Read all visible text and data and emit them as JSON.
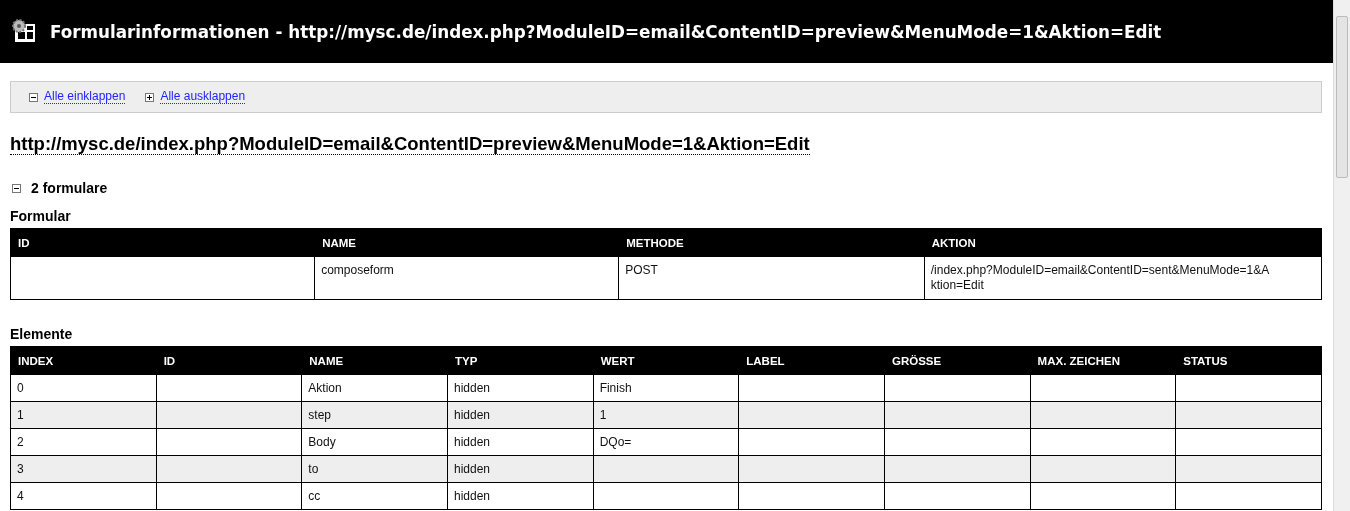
{
  "title_bar": {
    "title": "Formularinformationen - http://mysc.de/index.php?ModuleID=email&ContentID=preview&MenuMode=1&Aktion=Edit"
  },
  "toolbar": [
    {
      "label": "Alle einklappen",
      "kind": "collapse"
    },
    {
      "label": "Alle ausklappen",
      "kind": "expand"
    }
  ],
  "url_heading": "http://mysc.de/index.php?ModuleID=email&ContentID=preview&MenuMode=1&Aktion=Edit",
  "section": {
    "label": "2 formulare",
    "expanded": true
  },
  "formular": {
    "heading": "Formular",
    "columns": [
      "ID",
      "NAME",
      "METHODE",
      "AKTION"
    ],
    "rows": [
      [
        null,
        "composeform",
        "POST",
        "/index.php?ModuleID=email&ContentID=sent&MenuMode=1&Aktion=Edit"
      ]
    ]
  },
  "elemente": {
    "heading": "Elemente",
    "columns": [
      "INDEX",
      "ID",
      "NAME",
      "TYP",
      "WERT",
      "LABEL",
      "GRÖSSE",
      "MAX. ZEICHEN",
      "STATUS"
    ],
    "rows": [
      [
        "0",
        null,
        "Aktion",
        "hidden",
        "Finish",
        null,
        null,
        null,
        null
      ],
      [
        "1",
        null,
        "step",
        "hidden",
        "1",
        null,
        null,
        null,
        null
      ],
      [
        "2",
        null,
        "Body",
        "hidden",
        "DQo=",
        null,
        null,
        null,
        null
      ],
      [
        "3",
        null,
        "to",
        "hidden",
        null,
        null,
        null,
        null,
        null
      ],
      [
        "4",
        null,
        "cc",
        "hidden",
        null,
        null,
        null,
        null,
        null
      ]
    ]
  }
}
